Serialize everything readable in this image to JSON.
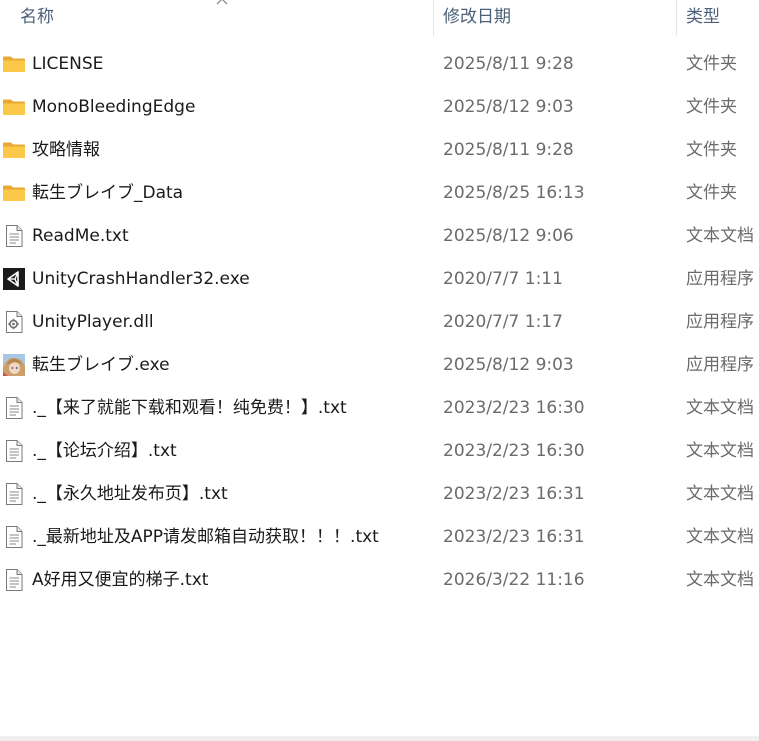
{
  "columns": {
    "name": "名称",
    "date": "修改日期",
    "type": "类型"
  },
  "files": [
    {
      "icon": "folder-icon",
      "name": "LICENSE",
      "date": "2025/8/11 9:28",
      "type": "文件夹"
    },
    {
      "icon": "folder-icon",
      "name": "MonoBleedingEdge",
      "date": "2025/8/12 9:03",
      "type": "文件夹"
    },
    {
      "icon": "folder-icon",
      "name": "攻略情報",
      "date": "2025/8/11 9:28",
      "type": "文件夹"
    },
    {
      "icon": "folder-icon",
      "name": "転生ブレイブ_Data",
      "date": "2025/8/25 16:13",
      "type": "文件夹"
    },
    {
      "icon": "text-file-icon",
      "name": "ReadMe.txt",
      "date": "2025/8/12 9:06",
      "type": "文本文档"
    },
    {
      "icon": "unity-icon",
      "name": "UnityCrashHandler32.exe",
      "date": "2020/7/7 1:11",
      "type": "应用程序"
    },
    {
      "icon": "dll-file-icon",
      "name": "UnityPlayer.dll",
      "date": "2020/7/7 1:17",
      "type": "应用程序"
    },
    {
      "icon": "game-app-icon",
      "name": "転生ブレイブ.exe",
      "date": "2025/8/12 9:03",
      "type": "应用程序"
    },
    {
      "icon": "text-file-icon",
      "name": "._【来了就能下载和观看！纯免费！】.txt",
      "date": "2023/2/23 16:30",
      "type": "文本文档"
    },
    {
      "icon": "text-file-icon",
      "name": "._【论坛介绍】.txt",
      "date": "2023/2/23 16:30",
      "type": "文本文档"
    },
    {
      "icon": "text-file-icon",
      "name": "._【永久地址发布页】.txt",
      "date": "2023/2/23 16:31",
      "type": "文本文档"
    },
    {
      "icon": "text-file-icon",
      "name": "._最新地址及APP请发邮箱自动获取！！！.txt",
      "date": "2023/2/23 16:31",
      "type": "文本文档"
    },
    {
      "icon": "text-file-icon",
      "name": "A好用又便宜的梯子.txt",
      "date": "2026/3/22 11:16",
      "type": "文本文档"
    }
  ]
}
